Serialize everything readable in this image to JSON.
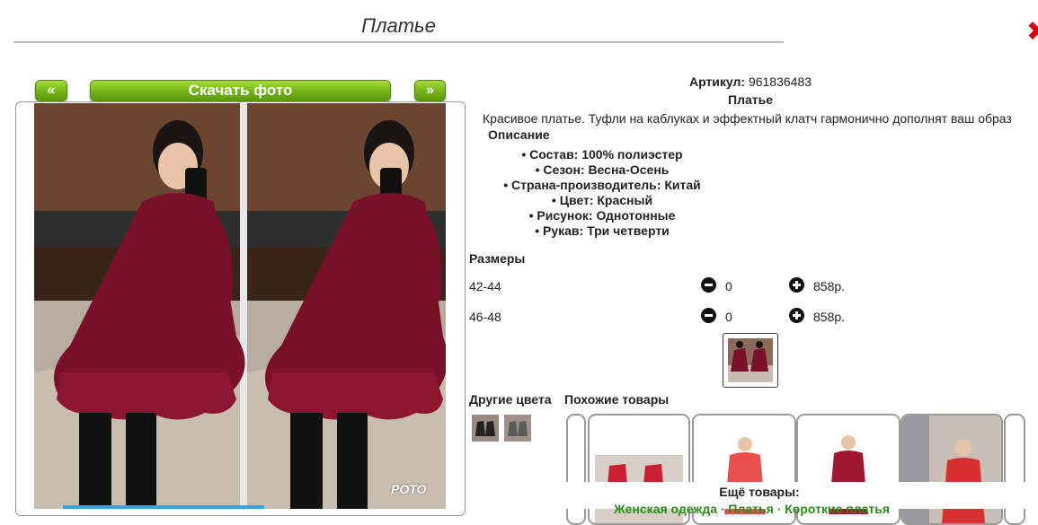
{
  "page": {
    "title": "Платье",
    "close_icon": "close-icon"
  },
  "gallery": {
    "prev_label": "«",
    "download_label": "Скачать фото",
    "next_label": "»",
    "watermark": "POTO"
  },
  "product": {
    "article_label": "Артикул:",
    "article_value": "961836483",
    "name": "Платье",
    "description": "Красивое платье. Туфли на каблуках и эффектный клатч гармонично дополнят ваш образ",
    "description_heading": "Описание",
    "attributes": [
      "• Состав: 100% полиэстер",
      "• Сезон: Весна-Осень",
      "• Страна-производитель: Китай",
      "• Цвет: Красный",
      "• Рисунок: Однотонные",
      "• Рукав: Три четверти"
    ]
  },
  "sizes": {
    "heading": "Размеры",
    "rows": [
      {
        "size": "42-44",
        "qty": "0",
        "price": "858р."
      },
      {
        "size": "46-48",
        "qty": "0",
        "price": "858р."
      }
    ]
  },
  "other_colors": {
    "heading": "Другие цвета"
  },
  "similar": {
    "heading": "Похожие товары"
  },
  "more": {
    "heading": "Ещё товары:",
    "links": "Женская одежда · Платья · Короткие платья"
  },
  "colors": {
    "accent_green": "#72b318",
    "dress_burgundy": "#7a1028",
    "link_green": "#2a8a1a",
    "close_red": "#d60000"
  }
}
